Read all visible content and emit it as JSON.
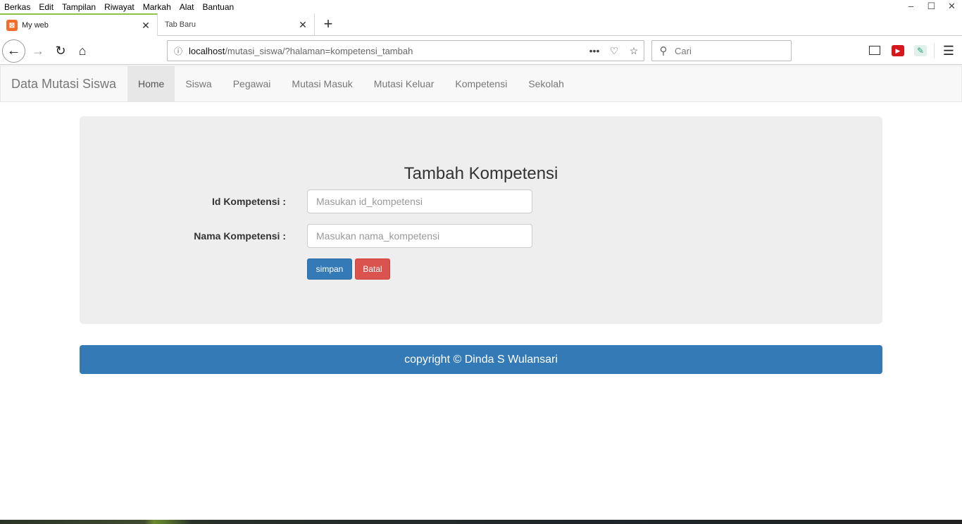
{
  "browser": {
    "menu": [
      {
        "label": "Berkas"
      },
      {
        "label": "Edit"
      },
      {
        "label": "Tampilan"
      },
      {
        "label": "Riwayat"
      },
      {
        "label": "Markah"
      },
      {
        "label": "Alat"
      },
      {
        "label": "Bantuan"
      }
    ],
    "tabs": [
      {
        "label": "My web",
        "icon": "xampp-favicon"
      },
      {
        "label": "Tab Baru"
      }
    ],
    "url": {
      "host": "localhost",
      "path": "/mutasi_siswa/?halaman=kompetensi_tambah"
    },
    "search_placeholder": "Cari"
  },
  "site": {
    "brand": "Data Mutasi Siswa",
    "nav": [
      {
        "label": "Home",
        "active": true
      },
      {
        "label": "Siswa"
      },
      {
        "label": "Pegawai"
      },
      {
        "label": "Mutasi Masuk"
      },
      {
        "label": "Mutasi Keluar"
      },
      {
        "label": "Kompetensi"
      },
      {
        "label": "Sekolah"
      }
    ]
  },
  "form": {
    "title": "Tambah Kompetensi",
    "fields": [
      {
        "label": "Id Kompetensi :",
        "placeholder": "Masukan id_kompetensi",
        "value": ""
      },
      {
        "label": "Nama Kompetensi :",
        "placeholder": "Masukan nama_kompetensi",
        "value": ""
      }
    ],
    "save_label": "simpan",
    "cancel_label": "Batal"
  },
  "footer": {
    "text": "copyright © Dinda S Wulansari"
  },
  "colors": {
    "primary": "#337ab7",
    "danger": "#d9534f",
    "tab_accent": "#8fc142"
  }
}
